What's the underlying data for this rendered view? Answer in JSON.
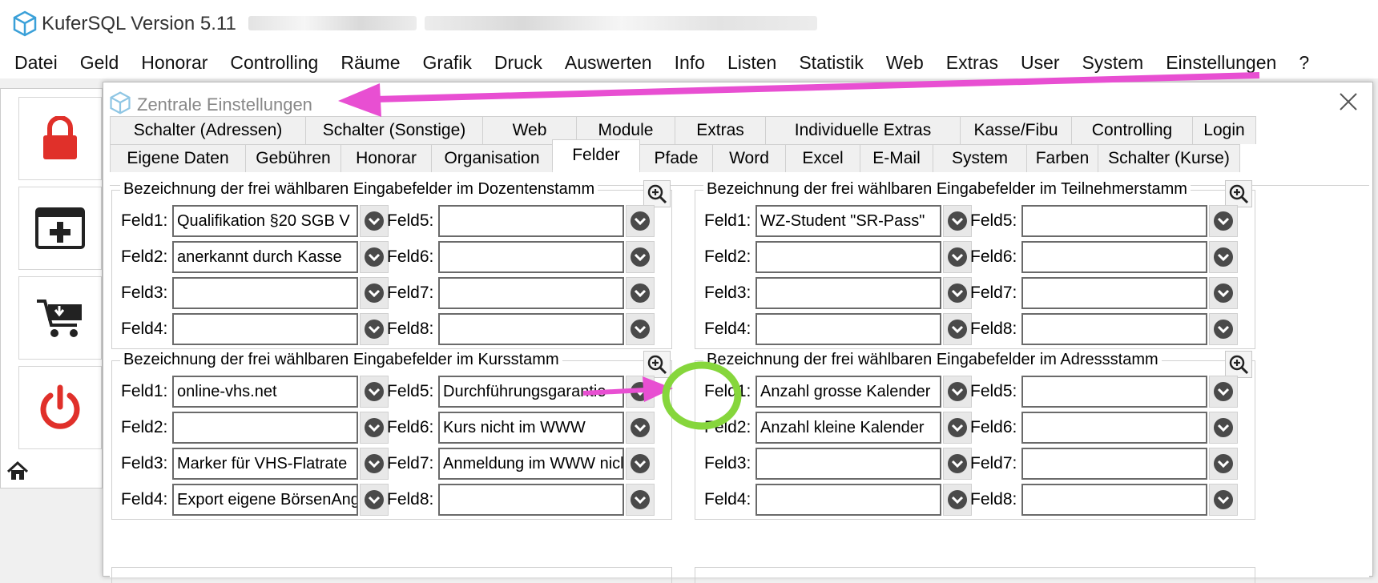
{
  "app": {
    "title": "KuferSQL Version 5.11",
    "menu": [
      "Datei",
      "Geld",
      "Honorar",
      "Controlling",
      "Räume",
      "Grafik",
      "Druck",
      "Auswerten",
      "Info",
      "Listen",
      "Statistik",
      "Web",
      "Extras",
      "User",
      "System",
      "Einstellungen",
      "?"
    ]
  },
  "sidebar": {
    "icons": [
      "lock-icon",
      "add-window-icon",
      "cart-download-icon",
      "power-icon",
      "home-icon"
    ]
  },
  "dialog": {
    "title": "Zentrale Einstellungen",
    "tabs_row1": [
      "Schalter (Adressen)",
      "Schalter (Sonstige)",
      "Web",
      "Module",
      "Extras",
      "Individuelle Extras",
      "Kasse/Fibu",
      "Controlling",
      "Login"
    ],
    "tabs_row2": [
      "Eigene Daten",
      "Gebühren",
      "Honorar",
      "Organisation",
      "Felder",
      "Pfade",
      "Word",
      "Excel",
      "E-Mail",
      "System",
      "Farben",
      "Schalter (Kurse)"
    ],
    "active_tab": "Felder",
    "groups": {
      "dozenten": {
        "legend": "Bezeichnung der frei wählbaren Eingabefelder im Dozentenstamm",
        "fields": [
          {
            "label": "Feld1:",
            "value": "Qualifikation §20 SGB V"
          },
          {
            "label": "Feld2:",
            "value": "anerkannt durch Kasse"
          },
          {
            "label": "Feld3:",
            "value": ""
          },
          {
            "label": "Feld4:",
            "value": ""
          },
          {
            "label": "Feld5:",
            "value": ""
          },
          {
            "label": "Feld6:",
            "value": ""
          },
          {
            "label": "Feld7:",
            "value": ""
          },
          {
            "label": "Feld8:",
            "value": ""
          }
        ]
      },
      "teilnehmer": {
        "legend": "Bezeichnung der frei wählbaren Eingabefelder im Teilnehmerstamm",
        "fields": [
          {
            "label": "Feld1:",
            "value": "WZ-Student \"SR-Pass\""
          },
          {
            "label": "Feld2:",
            "value": ""
          },
          {
            "label": "Feld3:",
            "value": ""
          },
          {
            "label": "Feld4:",
            "value": ""
          },
          {
            "label": "Feld5:",
            "value": ""
          },
          {
            "label": "Feld6:",
            "value": ""
          },
          {
            "label": "Feld7:",
            "value": ""
          },
          {
            "label": "Feld8:",
            "value": ""
          }
        ]
      },
      "kurs": {
        "legend": "Bezeichnung der frei wählbaren Eingabefelder im Kursstamm",
        "fields": [
          {
            "label": "Feld1:",
            "value": "online-vhs.net"
          },
          {
            "label": "Feld2:",
            "value": ""
          },
          {
            "label": "Feld3:",
            "value": "Marker für VHS-Flatrate"
          },
          {
            "label": "Feld4:",
            "value": "Export eigene BörsenAngebote"
          },
          {
            "label": "Feld5:",
            "value": "Durchführungsgarantie"
          },
          {
            "label": "Feld6:",
            "value": "Kurs nicht im WWW"
          },
          {
            "label": "Feld7:",
            "value": "Anmeldung im WWW nicht möglich"
          },
          {
            "label": "Feld8:",
            "value": ""
          }
        ]
      },
      "adress": {
        "legend": "Bezeichnung der frei wählbaren Eingabefelder im Adressstamm",
        "fields": [
          {
            "label": "Feld1:",
            "value": "Anzahl grosse Kalender"
          },
          {
            "label": "Feld2:",
            "value": "Anzahl kleine Kalender"
          },
          {
            "label": "Feld3:",
            "value": ""
          },
          {
            "label": "Feld4:",
            "value": ""
          },
          {
            "label": "Feld5:",
            "value": ""
          },
          {
            "label": "Feld6:",
            "value": ""
          },
          {
            "label": "Feld7:",
            "value": ""
          },
          {
            "label": "Feld8:",
            "value": ""
          }
        ]
      }
    }
  },
  "colors": {
    "annotation_arrow": "#e84fd2",
    "annotation_circle": "#86d63c",
    "lock_red": "#e0302a",
    "power_red": "#e0302a"
  }
}
